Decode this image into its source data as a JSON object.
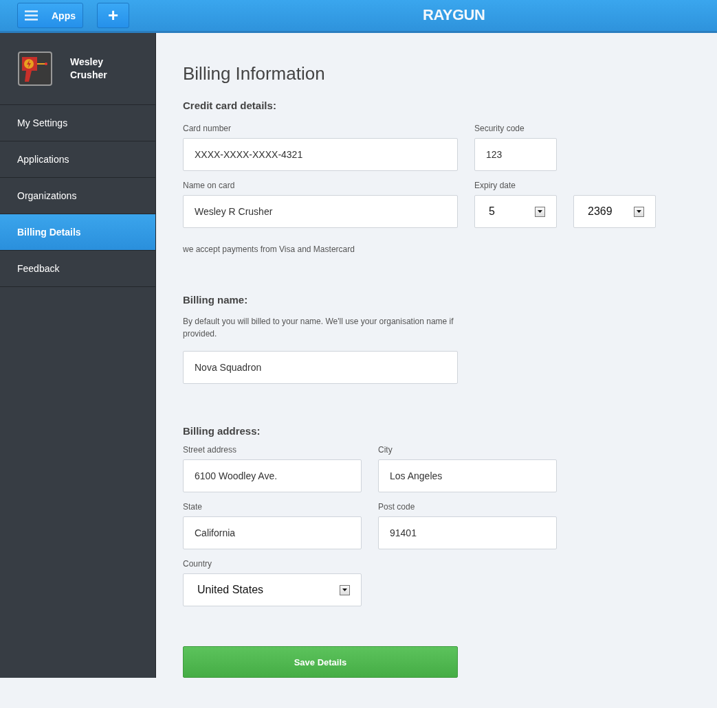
{
  "topbar": {
    "apps_button": "Apps",
    "add_button": "+",
    "logo": "RAYGUN"
  },
  "user": {
    "name": "Wesley Crusher"
  },
  "sidebar": {
    "items": [
      {
        "label": "My Settings",
        "selected": false
      },
      {
        "label": "Applications",
        "selected": false
      },
      {
        "label": "Organizations",
        "selected": false
      },
      {
        "label": "Billing Details",
        "selected": true
      },
      {
        "label": "Feedback",
        "selected": false
      }
    ]
  },
  "title": "Billing Information",
  "credit_card": {
    "heading": "Credit card details:",
    "card_number": {
      "label": "Card number",
      "value": "XXXX-XXXX-XXXX-4321"
    },
    "security_code": {
      "label": "Security code",
      "value": "123"
    },
    "name_on_card": {
      "label": "Name on card",
      "value": "Wesley R Crusher"
    },
    "expiry_date": {
      "label": "Expiry date",
      "month": "5",
      "year": "2369"
    },
    "note": "we accept payments from Visa and Mastercard"
  },
  "billing_name": {
    "heading": "Billing name:",
    "description": "By default you will billed to your name. We'll use your organisation name if provided.",
    "value": "Nova Squadron"
  },
  "billing_address": {
    "heading": "Billing address:",
    "street": {
      "label": "Street address",
      "value": "6100 Woodley Ave."
    },
    "city": {
      "label": "City",
      "value": "Los Angeles"
    },
    "state": {
      "label": "State",
      "value": "California"
    },
    "post_code": {
      "label": "Post code",
      "value": "91401"
    },
    "country": {
      "label": "Country",
      "value": "United States"
    }
  },
  "save_button": "Save Details"
}
